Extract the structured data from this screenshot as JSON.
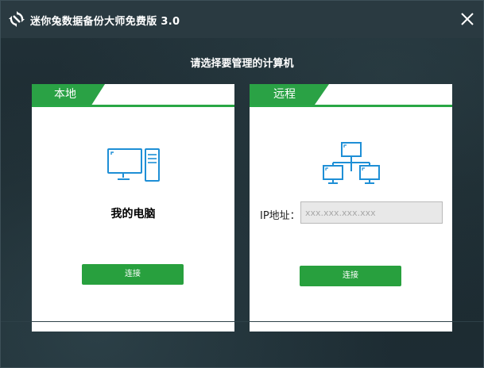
{
  "window": {
    "title": "迷你兔数据备份大师免费版 3.0",
    "subtitle": "请选择要管理的计算机"
  },
  "icons": {
    "logo": "minitool-logo-icon",
    "close": "close-icon",
    "computer": "desktop-computer-icon",
    "network": "network-computers-icon"
  },
  "local": {
    "tab_label": "本地",
    "device_label": "我的电脑",
    "connect_label": "连接"
  },
  "remote": {
    "tab_label": "远程",
    "ip_label": "IP地址：",
    "ip_placeholder": "xxx.xxx.xxx.xxx",
    "connect_label": "连接"
  },
  "colors": {
    "accent_green": "#28a745",
    "icon_blue": "#1e8fd6",
    "titlebar": "#2a3a41",
    "background": "#1f2f36"
  }
}
